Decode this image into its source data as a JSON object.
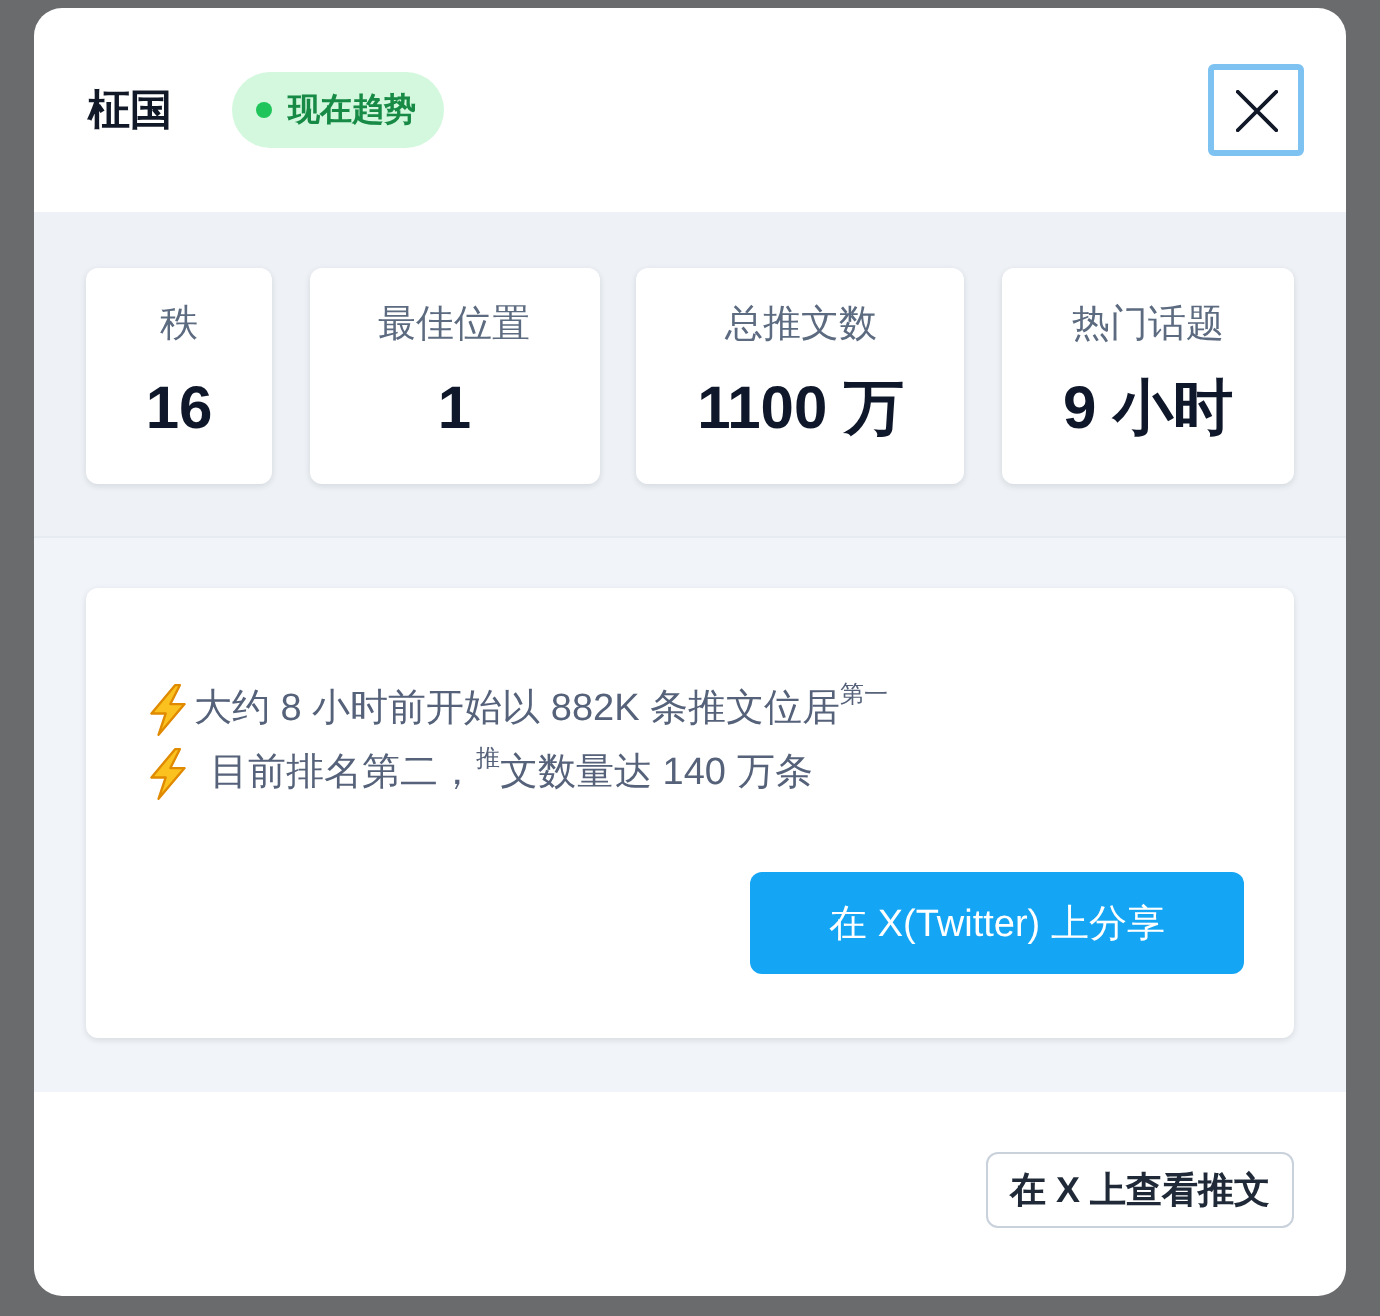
{
  "dialog": {
    "title": "柾国",
    "badge": {
      "label": "现在趋势"
    },
    "close_button": {
      "focused": true
    }
  },
  "stats": [
    {
      "label": "秩",
      "value": "16"
    },
    {
      "label": "最佳位置",
      "value": "1"
    },
    {
      "label": "总推文数",
      "value": "1100 万"
    },
    {
      "label": "热门话题",
      "value": "9 小时"
    }
  ],
  "highlights": [
    {
      "text": "大约 8 小时前开始以 882K 条推文位居$^{第一}$"
    },
    {
      "text": "目前排名第二，$^{推}$文数量达 140 万条"
    }
  ],
  "share_button": {
    "label": "在 X(Twitter) 上分享"
  },
  "footer_button": {
    "label": "在 X 上查看推文"
  }
}
